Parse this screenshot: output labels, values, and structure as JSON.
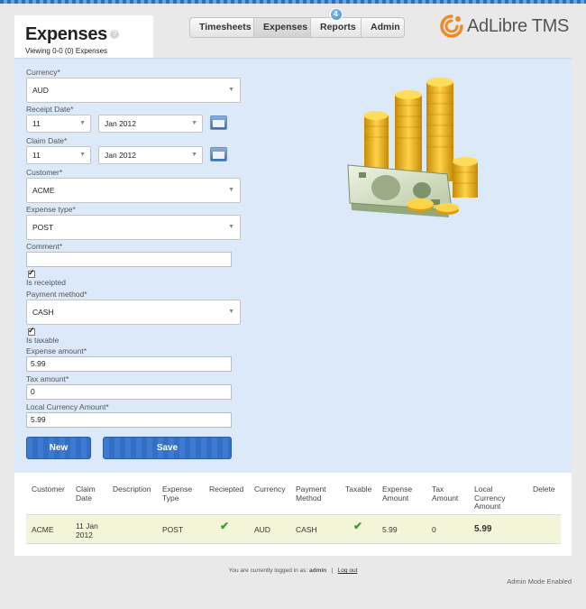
{
  "header": {
    "title": "Expenses",
    "help": "?",
    "subtitle": "Viewing 0-0 (0) Expenses"
  },
  "nav": {
    "tabs": [
      {
        "label": "Timesheets"
      },
      {
        "label": "Expenses"
      },
      {
        "label": "Reports",
        "badge": "4"
      },
      {
        "label": "Admin"
      }
    ]
  },
  "logo": {
    "brand": "AdLibre",
    "product": "TMS"
  },
  "form": {
    "currency_label": "Currency*",
    "currency_value": "AUD",
    "receipt_date_label": "Receipt Date*",
    "receipt_day": "11",
    "receipt_month": "Jan 2012",
    "claim_date_label": "Claim Date*",
    "claim_day": "11",
    "claim_month": "Jan 2012",
    "customer_label": "Customer*",
    "customer_value": "ACME",
    "expense_type_label": "Expense type*",
    "expense_type_value": "POST",
    "comment_label": "Comment*",
    "comment_value": "",
    "is_receipted_label": "Is receipted",
    "payment_method_label": "Payment method*",
    "payment_method_value": "CASH",
    "is_taxable_label": "Is taxable",
    "expense_amount_label": "Expense amount*",
    "expense_amount_value": "5.99",
    "tax_amount_label": "Tax amount*",
    "tax_amount_value": "0",
    "local_amount_label": "Local Currency Amount*",
    "local_amount_value": "5.99",
    "new_label": "New",
    "save_label": "Save"
  },
  "table": {
    "headers": {
      "customer": "Customer",
      "claim_date": "Claim Date",
      "description": "Description",
      "expense_type": "Expense Type",
      "reciepted": "Reciepted",
      "currency": "Currency",
      "payment_method": "Payment Method",
      "taxable": "Taxable",
      "expense_amount": "Expense Amount",
      "tax_amount": "Tax Amount",
      "local_amount": "Local Currency Amount",
      "delete": "Delete"
    },
    "row": {
      "customer": "ACME",
      "claim_date": "11 Jan 2012",
      "description": "",
      "expense_type": "POST",
      "currency": "AUD",
      "payment_method": "CASH",
      "expense_amount": "5.99",
      "tax_amount": "0",
      "local_amount": "5.99"
    }
  },
  "footer": {
    "logged_in_text": "You are currently logged in as:",
    "user": "admin",
    "separator": "|",
    "logout": "Log out",
    "admin_mode": "Admin Mode Enabled"
  },
  "colors": {
    "panel_bg": "#dce9f8",
    "button_blue": "#3370c5",
    "row_highlight": "#f3f5d9",
    "logo_orange": "#f08a24"
  }
}
